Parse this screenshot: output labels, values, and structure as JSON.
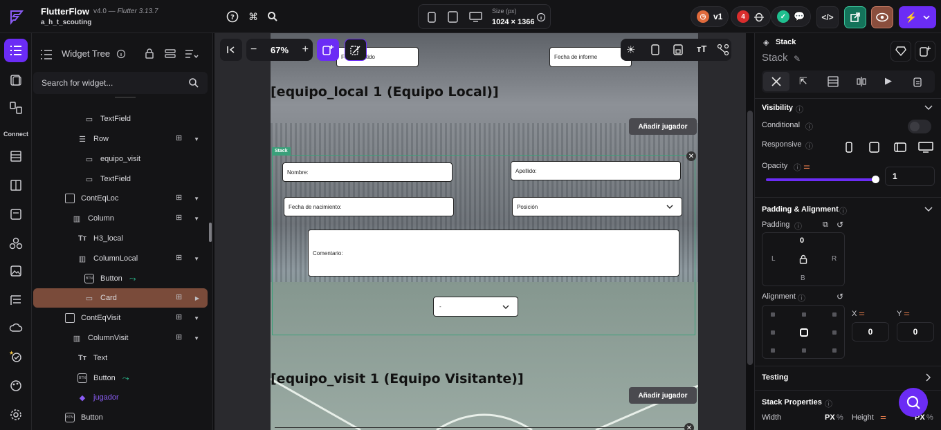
{
  "app": {
    "name": "FlutterFlow",
    "version": "v4.0 —",
    "flutter": "Flutter 3.13.7",
    "project": "a_h_t_scouting"
  },
  "topbar": {
    "size_label": "Size (px)",
    "size_value": "1024 × 1366",
    "version_badge": "v1",
    "issues_count": "4"
  },
  "rail": {
    "connect_label": "Connect"
  },
  "tree": {
    "title": "Widget Tree",
    "search_placeholder": "Search for widget...",
    "rows": [
      {
        "label": "TextField",
        "icon": "textfield-icon"
      },
      {
        "label": "Row",
        "icon": "row-icon"
      },
      {
        "label": "equipo_visit",
        "icon": "textfield-icon"
      },
      {
        "label": "TextField",
        "icon": "textfield-icon"
      },
      {
        "label": "ContEqLoc",
        "icon": "container-icon"
      },
      {
        "label": "Column",
        "icon": "column-icon"
      },
      {
        "label": "H3_local",
        "icon": "text-icon"
      },
      {
        "label": "ColumnLocal",
        "icon": "column-icon"
      },
      {
        "label": "Button",
        "icon": "button-icon"
      },
      {
        "label": "Card",
        "icon": "card-icon"
      },
      {
        "label": "ContEqVisit",
        "icon": "container-icon"
      },
      {
        "label": "ColumnVisit",
        "icon": "column-icon"
      },
      {
        "label": "Text",
        "icon": "text-icon"
      },
      {
        "label": "Button",
        "icon": "button-icon"
      },
      {
        "label": "jugador",
        "icon": "component-icon"
      },
      {
        "label": "Button",
        "icon": "button-icon"
      }
    ]
  },
  "canvas": {
    "zoom": "67%",
    "field_fecha_partido": "Fecha partido",
    "field_fecha_informe": "Fecha de informe",
    "heading_local": "[equipo_local 1 (Equipo Local)]",
    "heading_visit": "[equipo_visit 1 (Equipo Visitante)]",
    "add_player_label": "Añadir jugador",
    "stack_tag": "Stack",
    "nombre": "Nombre:",
    "apellido": "Apellido:",
    "fecha_nacimiento": "Fecha de nacimiento:",
    "posicion": "Posición",
    "comentario": "Comentario:",
    "dropdown_value": "-"
  },
  "props": {
    "type": "Stack",
    "name": "Stack",
    "visibility": "Visibility",
    "conditional": "Conditional",
    "responsive": "Responsive",
    "opacity_label": "Opacity",
    "opacity_value": "1",
    "opacity_fraction": 1.0,
    "padding_alignment": "Padding & Alignment",
    "padding_label": "Padding",
    "padding_top": "0",
    "pad_l": "L",
    "pad_r": "R",
    "pad_b": "B",
    "alignment_label": "Alignment",
    "x_label": "X",
    "y_label": "Y",
    "x_value": "0",
    "y_value": "0",
    "testing": "Testing",
    "stack_properties": "Stack Properties",
    "width_label": "Width",
    "height_label": "Height",
    "unit_px": "PX",
    "unit_pct": "%"
  },
  "colors": {
    "accent": "#6b2cf5",
    "selection": "#7a4b3a",
    "stack_outline": "#3aa07a"
  }
}
